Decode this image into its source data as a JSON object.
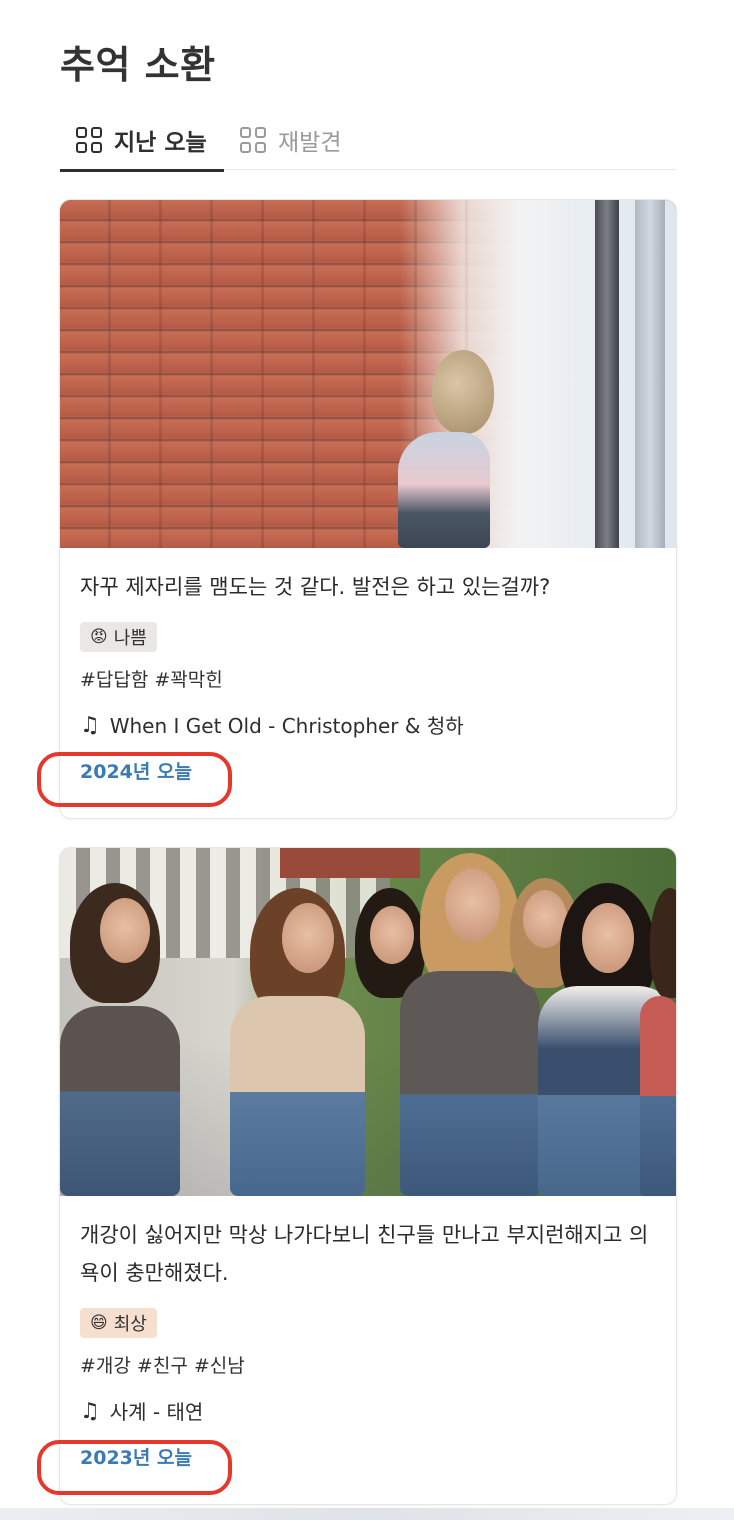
{
  "page": {
    "title": "추억 소환"
  },
  "tabs": [
    {
      "label": "지난 오늘",
      "active": true
    },
    {
      "label": "재발견",
      "active": false
    }
  ],
  "entries": [
    {
      "text": "자꾸 제자리를 맴도는 것 같다. 발전은 하고 있는걸까?",
      "mood": {
        "emoji": "😡",
        "label": "나쁨",
        "color": "#e9e8e6"
      },
      "tags": "#답답함 #꽉막힌",
      "music": {
        "icon": "music-note-icon",
        "glyph": "♫",
        "label": "When I Get Old - Christopher & 청하"
      },
      "date_link": "2024년 오늘"
    },
    {
      "text": "개강이 싫어지만 막상 나가다보니 친구들 만나고 부지런해지고 의욕이 충만해졌다.",
      "mood": {
        "emoji": "😄",
        "label": "최상",
        "color": "#f7dfcf"
      },
      "tags": "#개강 #친구 #신남",
      "music": {
        "icon": "music-note-icon",
        "glyph": "♫",
        "label": "사계 - 태연"
      },
      "date_link": "2023년 오늘"
    }
  ],
  "colors": {
    "link": "#3b7bb5",
    "highlight": "#e6372b",
    "active_tab": "#2f2f2f",
    "inactive_tab": "#9a9a9a"
  }
}
